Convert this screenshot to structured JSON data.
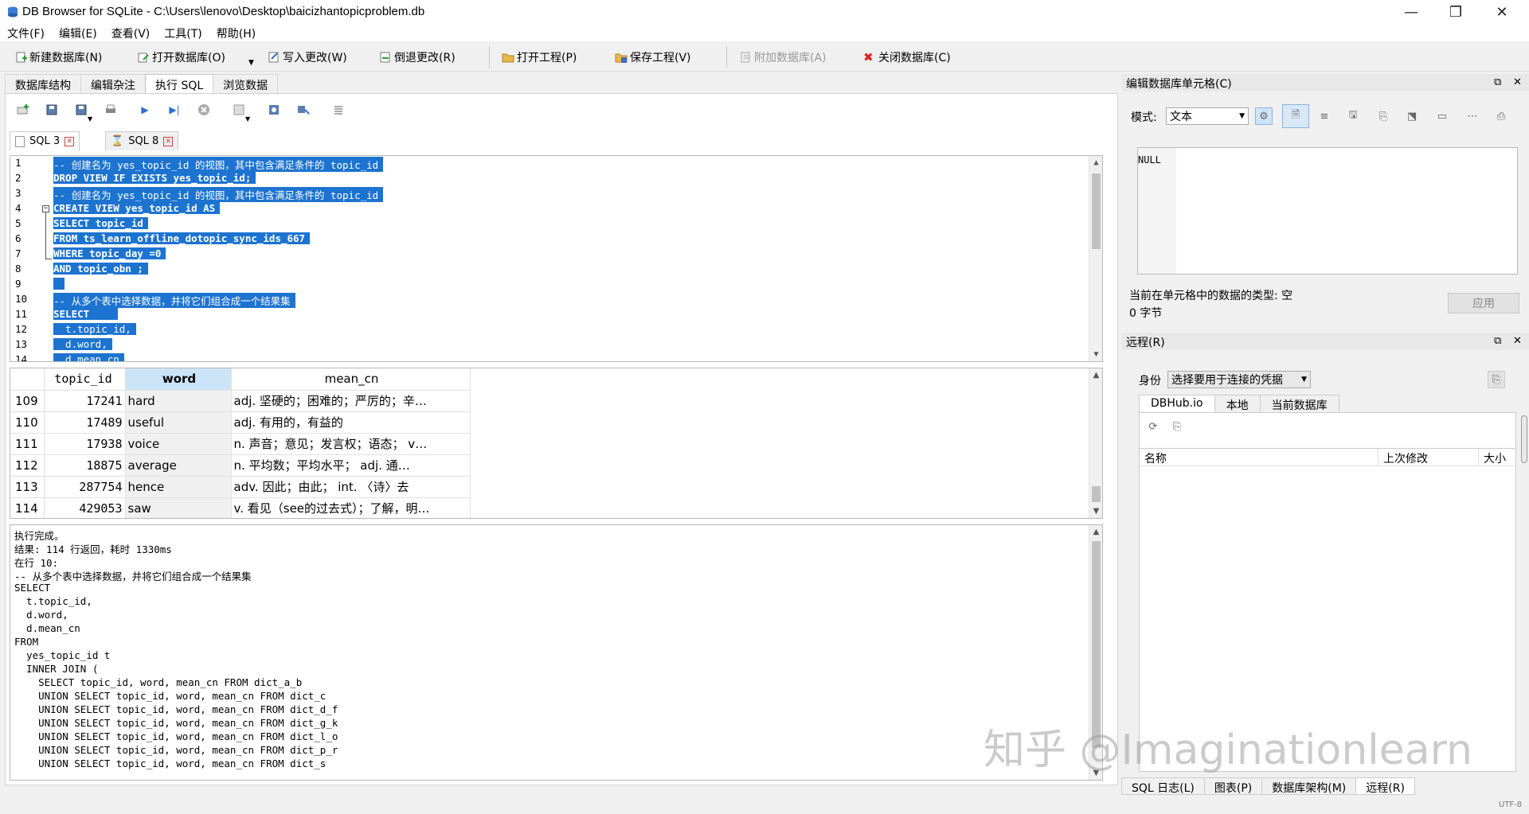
{
  "window": {
    "title": "DB Browser for SQLite - C:\\Users\\lenovo\\Desktop\\baicizhantopicproblem.db",
    "minimize": "—",
    "restore": "❐",
    "close": "✕"
  },
  "menu": [
    "文件(F)",
    "编辑(E)",
    "查看(V)",
    "工具(T)",
    "帮助(H)"
  ],
  "toolbar": {
    "new_db": "新建数据库(N)",
    "open_db": "打开数据库(O)",
    "write_changes": "写入更改(W)",
    "revert_changes": "倒退更改(R)",
    "open_project": "打开工程(P)",
    "save_project": "保存工程(V)",
    "attach_db": "附加数据库(A)",
    "close_db": "关闭数据库(C)"
  },
  "main_tabs": [
    "数据库结构",
    "编辑杂注",
    "执行 SQL",
    "浏览数据"
  ],
  "sql_tabs": [
    "SQL 3",
    "SQL 8"
  ],
  "editor": {
    "lines": [
      {
        "n": "1",
        "text": "-- 创建名为 yes_topic_id 的视图，其中包含满足条件的 topic_id",
        "bold": false
      },
      {
        "n": "2",
        "text": "DROP VIEW IF EXISTS yes_topic_id;",
        "bold": true
      },
      {
        "n": "3",
        "text": "-- 创建名为 yes_topic_id 的视图，其中包含满足条件的 topic_id",
        "bold": false
      },
      {
        "n": "4",
        "text": "CREATE VIEW yes_topic_id AS",
        "bold": true
      },
      {
        "n": "5",
        "text": "SELECT topic_id",
        "bold": true
      },
      {
        "n": "6",
        "text": "FROM ts_learn_offline_dotopic_sync_ids_667",
        "bold": true
      },
      {
        "n": "7",
        "text": "WHERE topic_day =0",
        "bold": true
      },
      {
        "n": "8",
        "text": "AND topic_obn ;",
        "bold": true
      },
      {
        "n": "9",
        "text": " ",
        "bold": false
      },
      {
        "n": "10",
        "text": "-- 从多个表中选择数据，并将它们组合成一个结果集",
        "bold": false
      },
      {
        "n": "11",
        "text": "SELECT    ",
        "bold": true
      },
      {
        "n": "12",
        "text": "  t.topic_id,",
        "bold": false
      },
      {
        "n": "13",
        "text": "  d.word,",
        "bold": false
      },
      {
        "n": "14",
        "text": "  d.mean_cn",
        "bold": false
      }
    ]
  },
  "results": {
    "columns": [
      "topic_id",
      "word",
      "mean_cn"
    ],
    "rows": [
      {
        "n": "109",
        "topic_id": "17241",
        "word": "hard",
        "mean_cn": "adj. 坚硬的；困难的；严厉的；辛…"
      },
      {
        "n": "110",
        "topic_id": "17489",
        "word": "useful",
        "mean_cn": "adj. 有用的，有益的"
      },
      {
        "n": "111",
        "topic_id": "17938",
        "word": "voice",
        "mean_cn": "n. 声音；意见；发言权；语态；  v…"
      },
      {
        "n": "112",
        "topic_id": "18875",
        "word": "average",
        "mean_cn": "n. 平均数；平均水平；  adj. 通…"
      },
      {
        "n": "113",
        "topic_id": "287754",
        "word": "hence",
        "mean_cn": "adv. 因此；由此；  int. 〈诗〉去"
      },
      {
        "n": "114",
        "topic_id": "429053",
        "word": "saw",
        "mean_cn": "v. 看见（see的过去式）；了解，明…"
      }
    ]
  },
  "messages": [
    "执行完成。",
    "结果: 114 行返回，耗时 1330ms",
    "在行 10:",
    "-- 从多个表中选择数据，并将它们组合成一个结果集",
    "SELECT",
    "  t.topic_id,",
    "  d.word,",
    "  d.mean_cn",
    "FROM",
    "  yes_topic_id t",
    "  INNER JOIN (",
    "    SELECT topic_id, word, mean_cn FROM dict_a_b",
    "    UNION SELECT topic_id, word, mean_cn FROM dict_c",
    "    UNION SELECT topic_id, word, mean_cn FROM dict_d_f",
    "    UNION SELECT topic_id, word, mean_cn FROM dict_g_k",
    "    UNION SELECT topic_id, word, mean_cn FROM dict_l_o",
    "    UNION SELECT topic_id, word, mean_cn FROM dict_p_r",
    "    UNION SELECT topic_id, word, mean_cn FROM dict_s"
  ],
  "cell_panel": {
    "title": "编辑数据库单元格(C)",
    "mode_label": "模式:",
    "mode_value": "文本",
    "value": "NULL",
    "type_text": "当前在单元格中的数据的类型: 空",
    "size_text": "0 字节",
    "apply": "应用"
  },
  "remote_panel": {
    "title": "远程(R)",
    "identity_label": "身份",
    "identity_value": "选择要用于连接的凭据",
    "tabs": [
      "DBHub.io",
      "本地",
      "当前数据库"
    ],
    "columns": [
      "名称",
      "上次修改",
      "大小"
    ]
  },
  "bottom_tabs": [
    "SQL 日志(L)",
    "图表(P)",
    "数据库架构(M)",
    "远程(R)"
  ],
  "status": "UTF-8",
  "watermark": "知乎 @Imaginationlearn"
}
